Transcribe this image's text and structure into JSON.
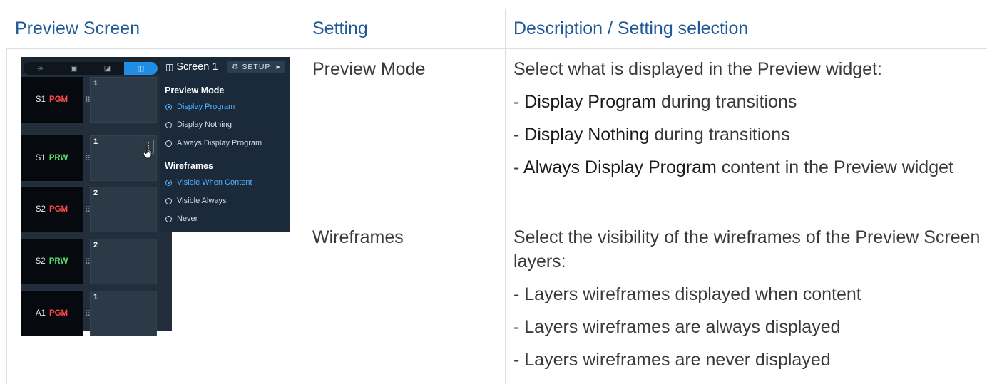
{
  "table": {
    "headers": [
      "Preview Screen",
      "Setting",
      "Description / Setting selection"
    ],
    "rows": [
      {
        "setting": "Preview Mode",
        "description": {
          "intro": "Select what is displayed in the Preview widget:",
          "items": [
            {
              "prefix": "- ",
              "bold": "Display Program",
              "rest": " during transitions"
            },
            {
              "prefix": "- ",
              "bold": "Display Nothing",
              "rest": " during transitions"
            },
            {
              "prefix": "- ",
              "bold": "Always Display Program",
              "rest": " content in the Preview widget"
            }
          ]
        }
      },
      {
        "setting": "Wireframes",
        "description": {
          "intro": "Select the visibility of the wireframes of the Preview Screen layers:",
          "items": [
            {
              "text": "- Layers wireframes displayed when content"
            },
            {
              "text": "- Layers wireframes are always displayed"
            },
            {
              "text": "- Layers wireframes are never displayed"
            }
          ]
        }
      }
    ]
  },
  "screenshot": {
    "tabs": [
      {
        "icon": "input-icon",
        "glyph": "⎆",
        "active": false
      },
      {
        "icon": "image-icon",
        "glyph": "▣",
        "active": false
      },
      {
        "icon": "edit-icon",
        "glyph": "◪",
        "active": false
      },
      {
        "icon": "screen-icon",
        "glyph": "◫",
        "active": true
      }
    ],
    "screen_title": "Screen 1",
    "setup_label": "SETUP",
    "rows": [
      {
        "name": "S1",
        "tag": "PGM",
        "num": "1"
      },
      {
        "name": "S1",
        "tag": "PRW",
        "num": "1",
        "kebab": true
      },
      {
        "name": "S2",
        "tag": "PGM",
        "num": "2"
      },
      {
        "name": "S2",
        "tag": "PRW",
        "num": "2"
      },
      {
        "name": "A1",
        "tag": "PGM",
        "num": "1"
      }
    ],
    "menu": {
      "preview_mode_title": "Preview Mode",
      "preview_mode_options": [
        {
          "label": "Display Program",
          "selected": true
        },
        {
          "label": "Display Nothing",
          "selected": false
        },
        {
          "label": "Always Display Program",
          "selected": false
        }
      ],
      "wireframes_title": "Wireframes",
      "wireframes_options": [
        {
          "label": "Visible When Content",
          "selected": true
        },
        {
          "label": "Visible Always",
          "selected": false
        },
        {
          "label": "Never",
          "selected": false
        }
      ]
    }
  }
}
